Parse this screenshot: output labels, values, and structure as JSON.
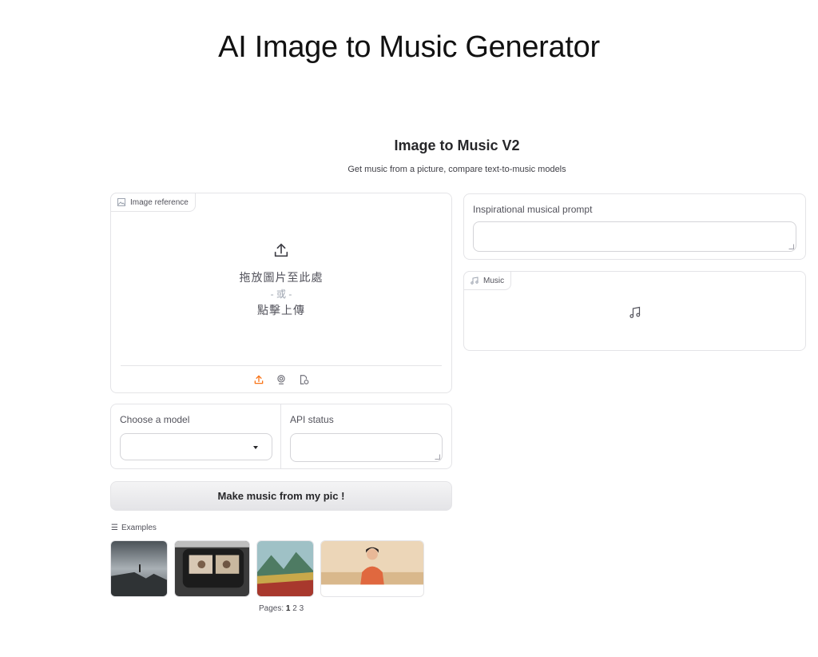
{
  "page": {
    "title": "AI Image to Music Generator"
  },
  "app": {
    "title": "Image to Music V2",
    "subtitle": "Get music from a picture, compare text-to-music models"
  },
  "image_input": {
    "label": "Image reference",
    "drop_text": "拖放圖片至此處",
    "or_text": "- 或 -",
    "click_text": "點擊上傳",
    "sources": [
      "upload-icon",
      "webcam-icon",
      "clipboard-icon"
    ]
  },
  "model": {
    "label": "Choose a model",
    "selected": ""
  },
  "api_status": {
    "label": "API status",
    "value": ""
  },
  "generate": {
    "label": "Make music from my pic !"
  },
  "examples": {
    "label": "Examples",
    "pages_label": "Pages:",
    "pages": [
      "1",
      "2",
      "3"
    ],
    "current_page": "1"
  },
  "prompt": {
    "label": "Inspirational musical prompt",
    "value": ""
  },
  "music": {
    "label": "Music"
  },
  "colors": {
    "accent": "#f97316",
    "border": "#e4e4e7",
    "text": "#27272a"
  }
}
